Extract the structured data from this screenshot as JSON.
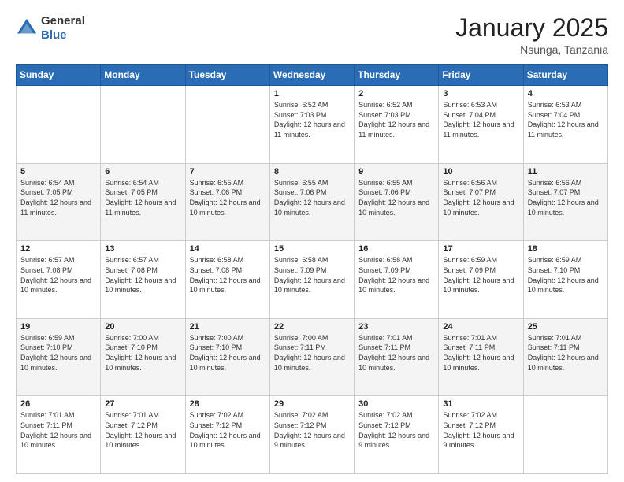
{
  "header": {
    "logo": {
      "general": "General",
      "blue": "Blue"
    },
    "title": "January 2025",
    "location": "Nsunga, Tanzania"
  },
  "days_of_week": [
    "Sunday",
    "Monday",
    "Tuesday",
    "Wednesday",
    "Thursday",
    "Friday",
    "Saturday"
  ],
  "weeks": [
    [
      {
        "day": "",
        "sunrise": "",
        "sunset": "",
        "daylight": ""
      },
      {
        "day": "",
        "sunrise": "",
        "sunset": "",
        "daylight": ""
      },
      {
        "day": "",
        "sunrise": "",
        "sunset": "",
        "daylight": ""
      },
      {
        "day": "1",
        "sunrise": "Sunrise: 6:52 AM",
        "sunset": "Sunset: 7:03 PM",
        "daylight": "Daylight: 12 hours and 11 minutes."
      },
      {
        "day": "2",
        "sunrise": "Sunrise: 6:52 AM",
        "sunset": "Sunset: 7:03 PM",
        "daylight": "Daylight: 12 hours and 11 minutes."
      },
      {
        "day": "3",
        "sunrise": "Sunrise: 6:53 AM",
        "sunset": "Sunset: 7:04 PM",
        "daylight": "Daylight: 12 hours and 11 minutes."
      },
      {
        "day": "4",
        "sunrise": "Sunrise: 6:53 AM",
        "sunset": "Sunset: 7:04 PM",
        "daylight": "Daylight: 12 hours and 11 minutes."
      }
    ],
    [
      {
        "day": "5",
        "sunrise": "Sunrise: 6:54 AM",
        "sunset": "Sunset: 7:05 PM",
        "daylight": "Daylight: 12 hours and 11 minutes."
      },
      {
        "day": "6",
        "sunrise": "Sunrise: 6:54 AM",
        "sunset": "Sunset: 7:05 PM",
        "daylight": "Daylight: 12 hours and 11 minutes."
      },
      {
        "day": "7",
        "sunrise": "Sunrise: 6:55 AM",
        "sunset": "Sunset: 7:06 PM",
        "daylight": "Daylight: 12 hours and 10 minutes."
      },
      {
        "day": "8",
        "sunrise": "Sunrise: 6:55 AM",
        "sunset": "Sunset: 7:06 PM",
        "daylight": "Daylight: 12 hours and 10 minutes."
      },
      {
        "day": "9",
        "sunrise": "Sunrise: 6:55 AM",
        "sunset": "Sunset: 7:06 PM",
        "daylight": "Daylight: 12 hours and 10 minutes."
      },
      {
        "day": "10",
        "sunrise": "Sunrise: 6:56 AM",
        "sunset": "Sunset: 7:07 PM",
        "daylight": "Daylight: 12 hours and 10 minutes."
      },
      {
        "day": "11",
        "sunrise": "Sunrise: 6:56 AM",
        "sunset": "Sunset: 7:07 PM",
        "daylight": "Daylight: 12 hours and 10 minutes."
      }
    ],
    [
      {
        "day": "12",
        "sunrise": "Sunrise: 6:57 AM",
        "sunset": "Sunset: 7:08 PM",
        "daylight": "Daylight: 12 hours and 10 minutes."
      },
      {
        "day": "13",
        "sunrise": "Sunrise: 6:57 AM",
        "sunset": "Sunset: 7:08 PM",
        "daylight": "Daylight: 12 hours and 10 minutes."
      },
      {
        "day": "14",
        "sunrise": "Sunrise: 6:58 AM",
        "sunset": "Sunset: 7:08 PM",
        "daylight": "Daylight: 12 hours and 10 minutes."
      },
      {
        "day": "15",
        "sunrise": "Sunrise: 6:58 AM",
        "sunset": "Sunset: 7:09 PM",
        "daylight": "Daylight: 12 hours and 10 minutes."
      },
      {
        "day": "16",
        "sunrise": "Sunrise: 6:58 AM",
        "sunset": "Sunset: 7:09 PM",
        "daylight": "Daylight: 12 hours and 10 minutes."
      },
      {
        "day": "17",
        "sunrise": "Sunrise: 6:59 AM",
        "sunset": "Sunset: 7:09 PM",
        "daylight": "Daylight: 12 hours and 10 minutes."
      },
      {
        "day": "18",
        "sunrise": "Sunrise: 6:59 AM",
        "sunset": "Sunset: 7:10 PM",
        "daylight": "Daylight: 12 hours and 10 minutes."
      }
    ],
    [
      {
        "day": "19",
        "sunrise": "Sunrise: 6:59 AM",
        "sunset": "Sunset: 7:10 PM",
        "daylight": "Daylight: 12 hours and 10 minutes."
      },
      {
        "day": "20",
        "sunrise": "Sunrise: 7:00 AM",
        "sunset": "Sunset: 7:10 PM",
        "daylight": "Daylight: 12 hours and 10 minutes."
      },
      {
        "day": "21",
        "sunrise": "Sunrise: 7:00 AM",
        "sunset": "Sunset: 7:10 PM",
        "daylight": "Daylight: 12 hours and 10 minutes."
      },
      {
        "day": "22",
        "sunrise": "Sunrise: 7:00 AM",
        "sunset": "Sunset: 7:11 PM",
        "daylight": "Daylight: 12 hours and 10 minutes."
      },
      {
        "day": "23",
        "sunrise": "Sunrise: 7:01 AM",
        "sunset": "Sunset: 7:11 PM",
        "daylight": "Daylight: 12 hours and 10 minutes."
      },
      {
        "day": "24",
        "sunrise": "Sunrise: 7:01 AM",
        "sunset": "Sunset: 7:11 PM",
        "daylight": "Daylight: 12 hours and 10 minutes."
      },
      {
        "day": "25",
        "sunrise": "Sunrise: 7:01 AM",
        "sunset": "Sunset: 7:11 PM",
        "daylight": "Daylight: 12 hours and 10 minutes."
      }
    ],
    [
      {
        "day": "26",
        "sunrise": "Sunrise: 7:01 AM",
        "sunset": "Sunset: 7:11 PM",
        "daylight": "Daylight: 12 hours and 10 minutes."
      },
      {
        "day": "27",
        "sunrise": "Sunrise: 7:01 AM",
        "sunset": "Sunset: 7:12 PM",
        "daylight": "Daylight: 12 hours and 10 minutes."
      },
      {
        "day": "28",
        "sunrise": "Sunrise: 7:02 AM",
        "sunset": "Sunset: 7:12 PM",
        "daylight": "Daylight: 12 hours and 10 minutes."
      },
      {
        "day": "29",
        "sunrise": "Sunrise: 7:02 AM",
        "sunset": "Sunset: 7:12 PM",
        "daylight": "Daylight: 12 hours and 9 minutes."
      },
      {
        "day": "30",
        "sunrise": "Sunrise: 7:02 AM",
        "sunset": "Sunset: 7:12 PM",
        "daylight": "Daylight: 12 hours and 9 minutes."
      },
      {
        "day": "31",
        "sunrise": "Sunrise: 7:02 AM",
        "sunset": "Sunset: 7:12 PM",
        "daylight": "Daylight: 12 hours and 9 minutes."
      },
      {
        "day": "",
        "sunrise": "",
        "sunset": "",
        "daylight": ""
      }
    ]
  ]
}
